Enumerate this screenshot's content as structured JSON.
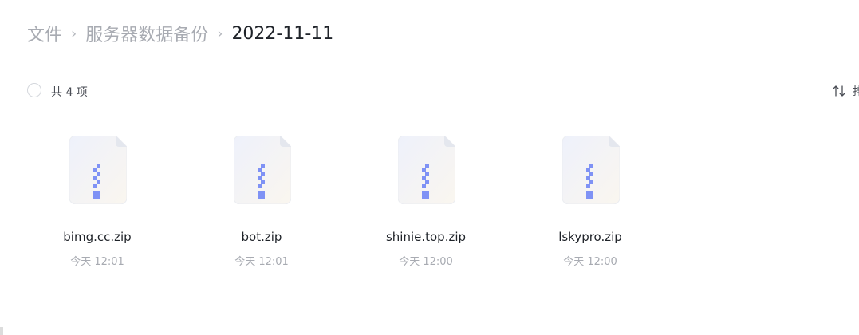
{
  "breadcrumb": {
    "items": [
      {
        "label": "文件"
      },
      {
        "label": "服务器数据备份"
      },
      {
        "label": "2022-11-11"
      }
    ],
    "separator": "›"
  },
  "toolbar": {
    "count_label": "共 4 项",
    "sort_label": "排"
  },
  "files": [
    {
      "name": "bimg.cc.zip",
      "time": "今天 12:01",
      "icon": "zip-file-icon"
    },
    {
      "name": "bot.zip",
      "time": "今天 12:01",
      "icon": "zip-file-icon"
    },
    {
      "name": "shinie.top.zip",
      "time": "今天 12:00",
      "icon": "zip-file-icon"
    },
    {
      "name": "lskypro.zip",
      "time": "今天 12:00",
      "icon": "zip-file-icon"
    }
  ],
  "colors": {
    "zipper": "#7f92f5",
    "text_primary": "#1f2329",
    "text_muted": "#a8abb2"
  }
}
